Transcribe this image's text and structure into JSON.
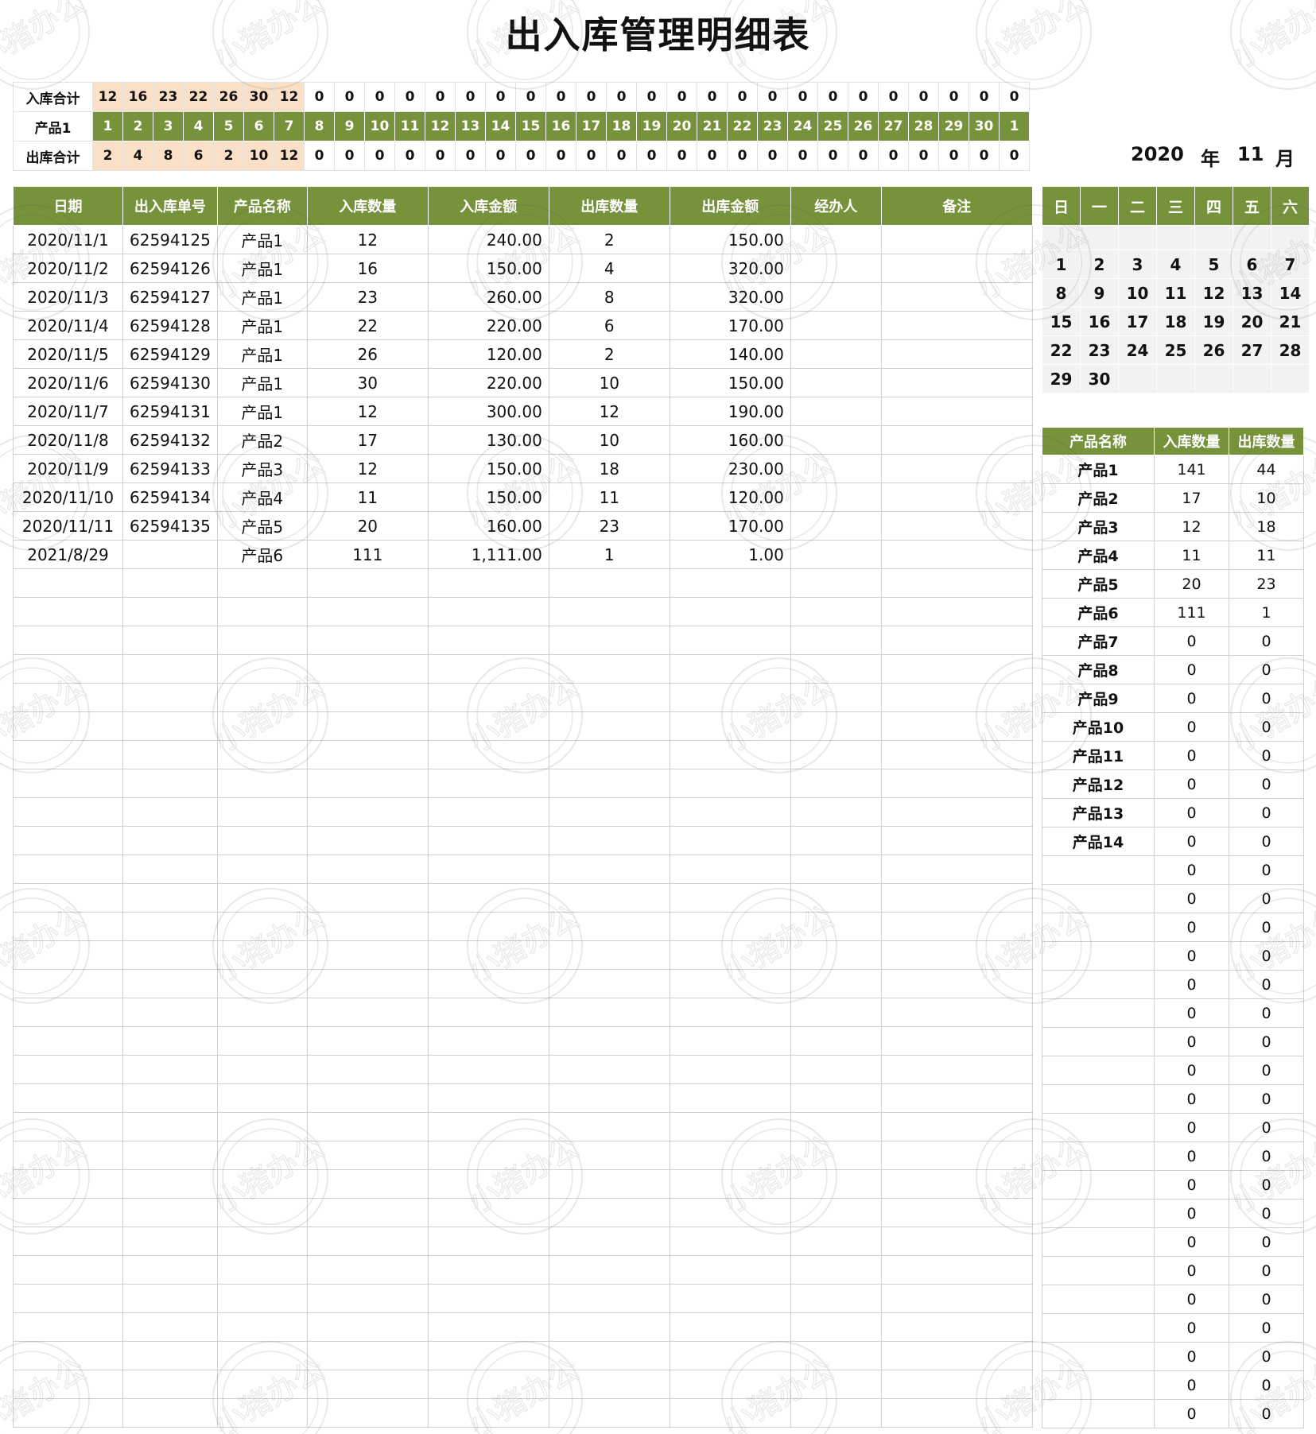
{
  "title": "出入库管理明细表",
  "colors": {
    "accent": "#76933c",
    "highlight": "#fbe0c8",
    "grid": "#d0d0d0"
  },
  "summary": {
    "in_label": "入库合计",
    "product_label": "产品1",
    "out_label": "出库合计",
    "in_values": [
      "12",
      "16",
      "23",
      "22",
      "26",
      "30",
      "12",
      "0",
      "0",
      "0",
      "0",
      "0",
      "0",
      "0",
      "0",
      "0",
      "0",
      "0",
      "0",
      "0",
      "0",
      "0",
      "0",
      "0",
      "0",
      "0",
      "0",
      "0",
      "0",
      "0",
      "0"
    ],
    "days": [
      "1",
      "2",
      "3",
      "4",
      "5",
      "6",
      "7",
      "8",
      "9",
      "10",
      "11",
      "12",
      "13",
      "14",
      "15",
      "16",
      "17",
      "18",
      "19",
      "20",
      "21",
      "22",
      "23",
      "24",
      "25",
      "26",
      "27",
      "28",
      "29",
      "30",
      "1"
    ],
    "out_values": [
      "2",
      "4",
      "8",
      "6",
      "2",
      "10",
      "12",
      "0",
      "0",
      "0",
      "0",
      "0",
      "0",
      "0",
      "0",
      "0",
      "0",
      "0",
      "0",
      "0",
      "0",
      "0",
      "0",
      "0",
      "0",
      "0",
      "0",
      "0",
      "0",
      "0",
      "0"
    ]
  },
  "ledger": {
    "headers": [
      "日期",
      "出入库单号",
      "产品名称",
      "入库数量",
      "入库金额",
      "出库数量",
      "出库金额",
      "经办人",
      "备注"
    ],
    "rows": [
      [
        "2020/11/1",
        "62594125",
        "产品1",
        "12",
        "240.00",
        "2",
        "150.00",
        "",
        ""
      ],
      [
        "2020/11/2",
        "62594126",
        "产品1",
        "16",
        "150.00",
        "4",
        "320.00",
        "",
        ""
      ],
      [
        "2020/11/3",
        "62594127",
        "产品1",
        "23",
        "260.00",
        "8",
        "320.00",
        "",
        ""
      ],
      [
        "2020/11/4",
        "62594128",
        "产品1",
        "22",
        "220.00",
        "6",
        "170.00",
        "",
        ""
      ],
      [
        "2020/11/5",
        "62594129",
        "产品1",
        "26",
        "120.00",
        "2",
        "140.00",
        "",
        ""
      ],
      [
        "2020/11/6",
        "62594130",
        "产品1",
        "30",
        "220.00",
        "10",
        "150.00",
        "",
        ""
      ],
      [
        "2020/11/7",
        "62594131",
        "产品1",
        "12",
        "300.00",
        "12",
        "190.00",
        "",
        ""
      ],
      [
        "2020/11/8",
        "62594132",
        "产品2",
        "17",
        "130.00",
        "10",
        "160.00",
        "",
        ""
      ],
      [
        "2020/11/9",
        "62594133",
        "产品3",
        "12",
        "150.00",
        "18",
        "230.00",
        "",
        ""
      ],
      [
        "2020/11/10",
        "62594134",
        "产品4",
        "11",
        "150.00",
        "11",
        "120.00",
        "",
        ""
      ],
      [
        "2020/11/11",
        "62594135",
        "产品5",
        "20",
        "160.00",
        "23",
        "170.00",
        "",
        ""
      ],
      [
        "2021/8/29",
        "",
        "产品6",
        "111",
        "1,111.00",
        "1",
        "1.00",
        "",
        ""
      ]
    ]
  },
  "calendar": {
    "year": "2020",
    "year_unit": "年",
    "month": "11",
    "month_unit": "月",
    "weekdays": [
      "日",
      "一",
      "二",
      "三",
      "四",
      "五",
      "六"
    ],
    "weeks": [
      [
        "",
        "",
        "",
        "",
        "",
        "",
        ""
      ],
      [
        "1",
        "2",
        "3",
        "4",
        "5",
        "6",
        "7"
      ],
      [
        "8",
        "9",
        "10",
        "11",
        "12",
        "13",
        "14"
      ],
      [
        "15",
        "16",
        "17",
        "18",
        "19",
        "20",
        "21"
      ],
      [
        "22",
        "23",
        "24",
        "25",
        "26",
        "27",
        "28"
      ],
      [
        "29",
        "30",
        "",
        "",
        "",
        "",
        ""
      ]
    ]
  },
  "product_summary": {
    "headers": [
      "产品名称",
      "入库数量",
      "出库数量"
    ],
    "rows": [
      [
        "产品1",
        "141",
        "44"
      ],
      [
        "产品2",
        "17",
        "10"
      ],
      [
        "产品3",
        "12",
        "18"
      ],
      [
        "产品4",
        "11",
        "11"
      ],
      [
        "产品5",
        "20",
        "23"
      ],
      [
        "产品6",
        "111",
        "1"
      ],
      [
        "产品7",
        "0",
        "0"
      ],
      [
        "产品8",
        "0",
        "0"
      ],
      [
        "产品9",
        "0",
        "0"
      ],
      [
        "产品10",
        "0",
        "0"
      ],
      [
        "产品11",
        "0",
        "0"
      ],
      [
        "产品12",
        "0",
        "0"
      ],
      [
        "产品13",
        "0",
        "0"
      ],
      [
        "产品14",
        "0",
        "0"
      ],
      [
        "",
        "0",
        "0"
      ],
      [
        "",
        "0",
        "0"
      ],
      [
        "",
        "0",
        "0"
      ],
      [
        "",
        "0",
        "0"
      ],
      [
        "",
        "0",
        "0"
      ],
      [
        "",
        "0",
        "0"
      ],
      [
        "",
        "0",
        "0"
      ],
      [
        "",
        "0",
        "0"
      ],
      [
        "",
        "0",
        "0"
      ],
      [
        "",
        "0",
        "0"
      ],
      [
        "",
        "0",
        "0"
      ],
      [
        "",
        "0",
        "0"
      ],
      [
        "",
        "0",
        "0"
      ],
      [
        "",
        "0",
        "0"
      ],
      [
        "",
        "0",
        "0"
      ],
      [
        "",
        "0",
        "0"
      ],
      [
        "",
        "0",
        "0"
      ],
      [
        "",
        "0",
        "0"
      ],
      [
        "",
        "0",
        "0"
      ],
      [
        "",
        "0",
        "0"
      ]
    ]
  },
  "watermark": {
    "text": "小猪办公"
  }
}
